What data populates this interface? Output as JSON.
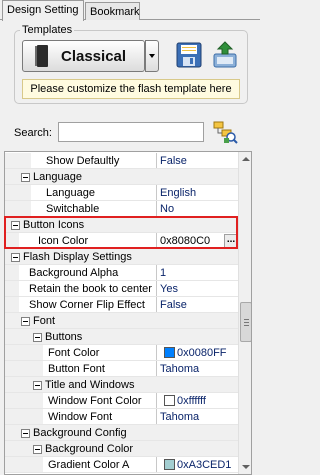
{
  "tabs": [
    {
      "label": "Design Setting",
      "active": true
    },
    {
      "label": "Bookmark",
      "active": false
    }
  ],
  "templates": {
    "label": "Templates",
    "selected": "Classical",
    "notice": "Please customize the flash template here",
    "icons": {
      "save": "save-icon",
      "export": "export-template-icon",
      "book": "book-icon"
    }
  },
  "search": {
    "label": "Search:",
    "value": "",
    "placeholder": "",
    "icon": "tree-search-icon"
  },
  "property_grid": {
    "rows": [
      {
        "name": "Show Defaultly",
        "value": "False",
        "level": 2,
        "type": "prop"
      },
      {
        "name": "Language",
        "value": "",
        "level": 1,
        "type": "cat"
      },
      {
        "name": "Language",
        "value": "English",
        "level": 2,
        "type": "prop"
      },
      {
        "name": "Switchable",
        "value": "No",
        "level": 2,
        "type": "prop"
      },
      {
        "name": "Button Icons",
        "value": "",
        "level": 0,
        "type": "cat"
      },
      {
        "name": "Icon Color",
        "value": "0x8080C0",
        "level": 1,
        "type": "prop",
        "selected": true
      },
      {
        "name": "Flash Display Settings",
        "value": "",
        "level": 0,
        "type": "cat"
      },
      {
        "name": "Background Alpha",
        "value": "1",
        "level": 1,
        "type": "prop"
      },
      {
        "name": "Retain the book to center",
        "value": "Yes",
        "level": 1,
        "type": "prop"
      },
      {
        "name": "Show Corner Flip Effect",
        "value": "False",
        "level": 1,
        "type": "prop"
      },
      {
        "name": "Font",
        "value": "",
        "level": 1,
        "type": "cat"
      },
      {
        "name": "Buttons",
        "value": "",
        "level": 2,
        "type": "cat"
      },
      {
        "name": "Font Color",
        "value": "0x0080FF",
        "level": 3,
        "type": "prop",
        "swatch": "#0080ff"
      },
      {
        "name": "Button Font",
        "value": "Tahoma",
        "level": 3,
        "type": "prop"
      },
      {
        "name": "Title and Windows",
        "value": "",
        "level": 2,
        "type": "cat"
      },
      {
        "name": "Window Font Color",
        "value": "0xffffff",
        "level": 3,
        "type": "prop",
        "swatch": "#ffffff"
      },
      {
        "name": "Window Font",
        "value": "Tahoma",
        "level": 3,
        "type": "prop"
      },
      {
        "name": "Background Config",
        "value": "",
        "level": 1,
        "type": "cat"
      },
      {
        "name": "Background Color",
        "value": "",
        "level": 2,
        "type": "cat"
      },
      {
        "name": "Gradient Color A",
        "value": "0xA3CED1",
        "level": 3,
        "type": "prop",
        "swatch": "#a3ced1"
      }
    ],
    "ellipsis": "..."
  },
  "colors": {
    "highlight": "#e02020",
    "value_text": "#0a246a",
    "notice_bg": "#fffbe0"
  }
}
